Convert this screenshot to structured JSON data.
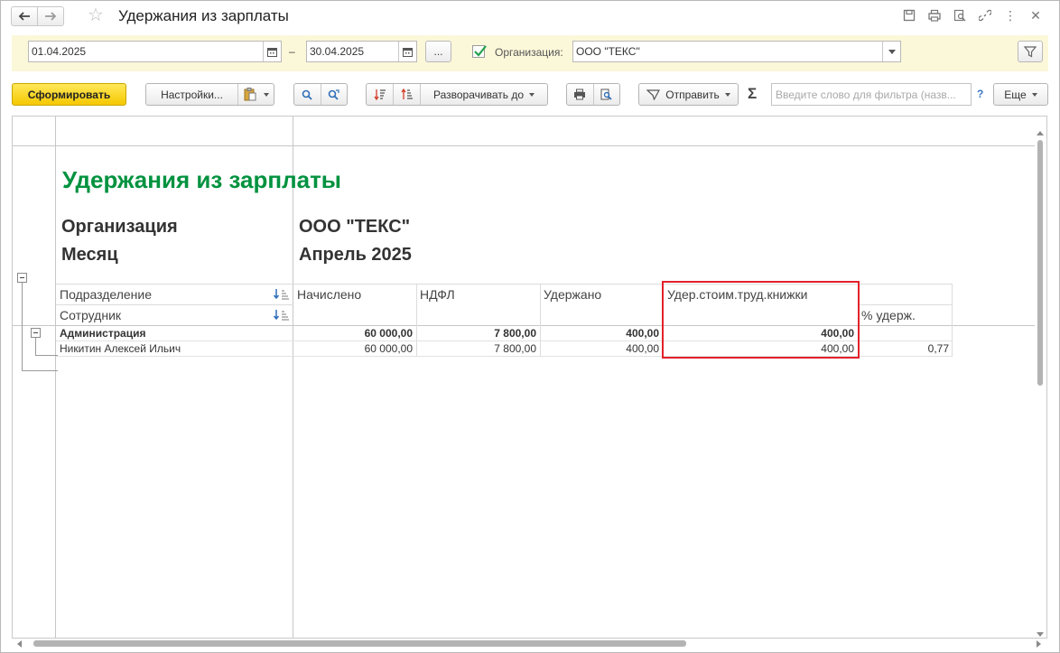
{
  "window": {
    "title": "Удержания из зарплаты"
  },
  "filters": {
    "date_from": "01.04.2025",
    "date_separator": "–",
    "date_to": "30.04.2025",
    "period_button_label": "...",
    "organization_enabled": true,
    "organization_label": "Организация:",
    "organization_value": "ООО \"ТЕКС\""
  },
  "toolbar": {
    "generate_label": "Сформировать",
    "settings_label": "Настройки...",
    "expand_label": "Разворачивать до",
    "send_label": "Отправить",
    "sum_symbol": "Σ",
    "filter_placeholder": "Введите слово для фильтра (назв...",
    "help_label": "?",
    "more_label": "Еще"
  },
  "report": {
    "title": "Удержания из зарплаты",
    "params": [
      {
        "label": "Организация",
        "value": "ООО \"ТЕКС\""
      },
      {
        "label": "Месяц",
        "value": "Апрель 2025"
      }
    ],
    "headers": {
      "group1": "Подразделение",
      "group2": "Сотрудник",
      "accrued": "Начислено",
      "ndfl": "НДФЛ",
      "withheld": "Удержано",
      "workbook_cost": "Удер.стоим.труд.книжки",
      "percent": "% удерж."
    },
    "rows": [
      {
        "name": "Администрация",
        "accrued": "60 000,00",
        "ndfl": "7 800,00",
        "withheld": "400,00",
        "workbook_cost": "400,00",
        "percent": ""
      },
      {
        "name": "Никитин Алексей Ильич",
        "accrued": "60 000,00",
        "ndfl": "7 800,00",
        "withheld": "400,00",
        "workbook_cost": "400,00",
        "percent": "0,77"
      }
    ]
  },
  "colors": {
    "report_title": "#00923f",
    "highlight_frame": "#e3212b",
    "primary_button": "#f5c800",
    "filter_strip": "#fbf7d9"
  }
}
